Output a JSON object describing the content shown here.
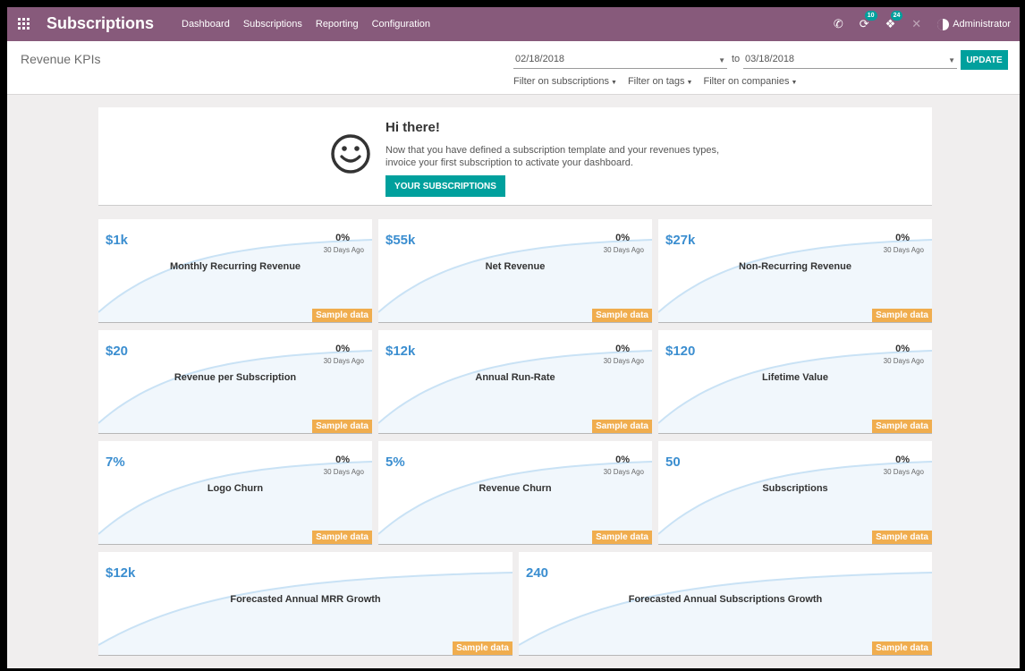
{
  "navbar": {
    "brand": "Subscriptions",
    "menu": [
      "Dashboard",
      "Subscriptions",
      "Reporting",
      "Configuration"
    ],
    "chat_badge": "10",
    "activity_badge": "24",
    "user": "Administrator"
  },
  "control": {
    "title": "Revenue KPIs",
    "date_from": "02/18/2018",
    "to_label": "to",
    "date_to": "03/18/2018",
    "update_label": "UPDATE",
    "filters": [
      "Filter on subscriptions",
      "Filter on tags",
      "Filter on companies"
    ]
  },
  "hello": {
    "title": "Hi there!",
    "line1": "Now that you have defined a subscription template and your revenues types,",
    "line2": "invoice your first subscription to activate your dashboard.",
    "button": "YOUR SUBSCRIPTIONS"
  },
  "kpis": [
    {
      "value": "$1k",
      "label": "Monthly Recurring Revenue",
      "pct": "0%",
      "ago": "30 Days Ago",
      "sample": "Sample data"
    },
    {
      "value": "$55k",
      "label": "Net Revenue",
      "pct": "0%",
      "ago": "30 Days Ago",
      "sample": "Sample data"
    },
    {
      "value": "$27k",
      "label": "Non-Recurring Revenue",
      "pct": "0%",
      "ago": "30 Days Ago",
      "sample": "Sample data"
    },
    {
      "value": "$20",
      "label": "Revenue per Subscription",
      "pct": "0%",
      "ago": "30 Days Ago",
      "sample": "Sample data"
    },
    {
      "value": "$12k",
      "label": "Annual Run-Rate",
      "pct": "0%",
      "ago": "30 Days Ago",
      "sample": "Sample data"
    },
    {
      "value": "$120",
      "label": "Lifetime Value",
      "pct": "0%",
      "ago": "30 Days Ago",
      "sample": "Sample data"
    },
    {
      "value": "7%",
      "label": "Logo Churn",
      "pct": "0%",
      "ago": "30 Days Ago",
      "sample": "Sample data"
    },
    {
      "value": "5%",
      "label": "Revenue Churn",
      "pct": "0%",
      "ago": "30 Days Ago",
      "sample": "Sample data"
    },
    {
      "value": "50",
      "label": "Subscriptions",
      "pct": "0%",
      "ago": "30 Days Ago",
      "sample": "Sample data"
    }
  ],
  "forecasts": [
    {
      "value": "$12k",
      "label": "Forecasted Annual MRR Growth",
      "sample": "Sample data"
    },
    {
      "value": "240",
      "label": "Forecasted Annual Subscriptions Growth",
      "sample": "Sample data"
    }
  ],
  "colors": {
    "navbar": "#875a7b",
    "accent": "#00a09d",
    "kpi_value": "#3b8ed0",
    "sample_badge": "#f0ad4e",
    "sparkline": "#c9e2f5"
  },
  "icons": [
    "apps-grid-icon",
    "phone-icon",
    "chat-icon",
    "activity-icon",
    "close-icon",
    "user-avatar-icon",
    "smiley-icon",
    "caret-down-icon"
  ]
}
